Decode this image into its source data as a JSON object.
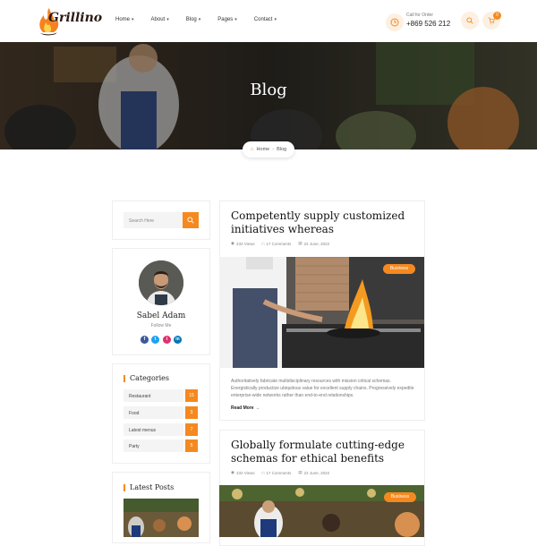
{
  "header": {
    "logo_text": "Grillino",
    "nav": [
      {
        "label": "Home"
      },
      {
        "label": "About"
      },
      {
        "label": "Blog"
      },
      {
        "label": "Pages"
      },
      {
        "label": "Contact"
      }
    ],
    "call_label": "Call for Order",
    "phone": "+869 526 212",
    "cart_count": "0"
  },
  "hero": {
    "title": "Blog",
    "breadcrumb": [
      "Home",
      "Blog"
    ]
  },
  "sidebar": {
    "search_placeholder": "Search Here",
    "author": {
      "name": "Sabel Adam",
      "follow": "Follow Me"
    },
    "social": [
      "f",
      "t",
      "i",
      "in"
    ],
    "categories_title": "Categories",
    "categories": [
      {
        "name": "Restaurant",
        "count": "15"
      },
      {
        "name": "Food",
        "count": "3"
      },
      {
        "name": "Latest menus",
        "count": "7"
      },
      {
        "name": "Party",
        "count": "5"
      }
    ],
    "latest_posts_title": "Latest Posts"
  },
  "posts": [
    {
      "title_line1": "Competently supply customized",
      "title_line2": "initiatives whereas",
      "views": "232 Views",
      "comments": "17 Comments",
      "date": "22 June, 2022",
      "tag": "Business",
      "excerpt": "Authoritatively fabricate multidisciplinary resources with mission critical schemas. Energistically productize ubiquitous value for excellent supply chains. Progressively expedite enterprise-wide networks rather than end-to-end relationships.",
      "read_more": "Read More"
    },
    {
      "title_line1": "Globally formulate cutting-edge",
      "title_line2": "schemas for ethical benefits",
      "views": "232 Views",
      "comments": "17 Comments",
      "date": "22 June, 2022",
      "tag": "Business"
    }
  ],
  "colors": {
    "accent": "#f5891f",
    "facebook": "#3b5998",
    "twitter": "#1da1f2",
    "instagram": "#e1306c",
    "linkedin": "#0077b5"
  }
}
